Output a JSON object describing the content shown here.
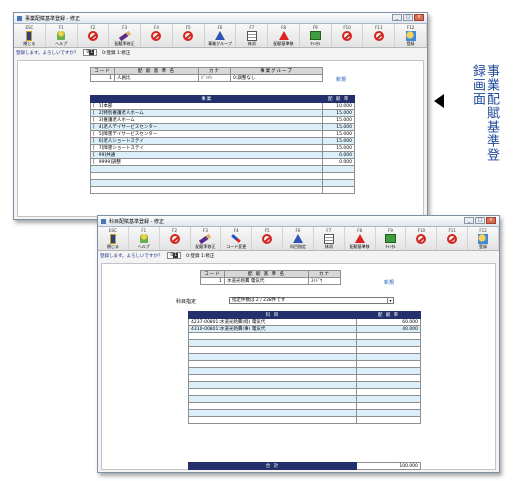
{
  "labels": {
    "arrow_label": "事業配賦基準登録画面"
  },
  "window1": {
    "title": "事業配賦基準登録 - 修正",
    "buttons": [
      {
        "key": "ESC",
        "label": "閉じる",
        "icon": "exit-door-icon"
      },
      {
        "key": "F1",
        "label": "ヘルプ",
        "icon": "help-icon"
      },
      {
        "key": "F2",
        "label": "",
        "icon": "disabled-icon"
      },
      {
        "key": "F3",
        "label": "配賦率修正",
        "icon": "pen-icon"
      },
      {
        "key": "F4",
        "label": "",
        "icon": "disabled-icon"
      },
      {
        "key": "F5",
        "label": "",
        "icon": "disabled-icon"
      },
      {
        "key": "F6",
        "label": "事業グループ",
        "icon": "triangle-icon"
      },
      {
        "key": "F7",
        "label": "抹消",
        "icon": "calculator-icon"
      },
      {
        "key": "F8",
        "label": "配賦基準移",
        "icon": "warning-icon"
      },
      {
        "key": "F9",
        "label": "ｷｬﾝｾﾙ",
        "icon": "check-icon"
      },
      {
        "key": "F10",
        "label": "",
        "icon": "disabled-icon"
      },
      {
        "key": "F11",
        "label": "",
        "icon": "disabled-icon"
      },
      {
        "key": "F12",
        "label": "登録",
        "icon": "register-icon"
      }
    ],
    "status": {
      "message": "登録します。よろしいですか？",
      "mode_prefix": "0",
      "mode_value": "1",
      "options": "0:登録  1:修正"
    },
    "master": {
      "headers": [
        "コード",
        "配 賦 基 準 名",
        "カナ",
        "事業グループ"
      ],
      "row": [
        "1",
        "人員比",
        "ｼﾞﾝｲﾝ",
        "0:調整なし"
      ],
      "new_link": "新規"
    },
    "detail": {
      "headers": [
        "事業",
        "配 賦 率"
      ],
      "rows": [
        [
          "[",
          "1]本部",
          "10.000"
        ],
        [
          "[",
          "2]特別養護老人ホーム",
          "15.000"
        ],
        [
          "[",
          "3]養護老人ホーム",
          "15.000"
        ],
        [
          "[",
          "4]老人デイサービスセンター",
          "15.000"
        ],
        [
          "[",
          "5]障害デイサービスセンター",
          "15.000"
        ],
        [
          "[",
          "6]老人ショートステイ",
          "15.000"
        ],
        [
          "[",
          "7]障害ショートステイ",
          "15.000"
        ],
        [
          "[",
          "99]共通",
          "0.000"
        ],
        [
          "[",
          "9999]調整",
          "0.000"
        ],
        [
          "",
          "",
          ""
        ],
        [
          "",
          "",
          ""
        ],
        [
          "",
          "",
          ""
        ],
        [
          "",
          "",
          ""
        ]
      ]
    }
  },
  "window2": {
    "title": "科目配賦基準登録 - 修正",
    "buttons": [
      {
        "key": "ESC",
        "label": "閉じる",
        "icon": "exit-door-icon"
      },
      {
        "key": "F1",
        "label": "ヘルプ",
        "icon": "help-icon"
      },
      {
        "key": "F2",
        "label": "",
        "icon": "disabled-icon"
      },
      {
        "key": "F3",
        "label": "配賦率修正",
        "icon": "pen-icon"
      },
      {
        "key": "F4",
        "label": "コード変更",
        "icon": "wand-icon"
      },
      {
        "key": "F5",
        "label": "",
        "icon": "disabled-icon"
      },
      {
        "key": "F6",
        "label": "科目指定",
        "icon": "triangle-icon"
      },
      {
        "key": "F7",
        "label": "抹消",
        "icon": "calculator-icon"
      },
      {
        "key": "F8",
        "label": "配賦基準移",
        "icon": "warning-icon"
      },
      {
        "key": "F9",
        "label": "ｷｬﾝｾﾙ",
        "icon": "check-icon"
      },
      {
        "key": "F10",
        "label": "",
        "icon": "disabled-icon"
      },
      {
        "key": "F11",
        "label": "",
        "icon": "disabled-icon"
      },
      {
        "key": "F12",
        "label": "登録",
        "icon": "register-icon"
      }
    ],
    "status": {
      "message": "登録します。よろしいですか？",
      "mode_prefix": "0",
      "mode_value": "1",
      "options": "0:登録  1:修正"
    },
    "master": {
      "headers": [
        "コード",
        "配 賦 基 準 名",
        "カナ"
      ],
      "row": [
        "1",
        "水道光熱費 電気代",
        "ｽｲﾄﾞｳ"
      ],
      "new_link": "新規"
    },
    "account_filter": {
      "label": "科目指定",
      "value": "指定件数は 2 / 238件です"
    },
    "detail": {
      "headers": [
        "科 目",
        "配 賦 率"
      ],
      "rows": [
        [
          "4237-00801:水道光熱費(経) 電気代",
          "60.000"
        ],
        [
          "4310-00801:水道光熱費(事) 電気代",
          "40.000"
        ],
        [
          "",
          ""
        ],
        [
          "",
          ""
        ],
        [
          "",
          ""
        ],
        [
          "",
          ""
        ],
        [
          "",
          ""
        ],
        [
          "",
          ""
        ],
        [
          "",
          ""
        ],
        [
          "",
          ""
        ],
        [
          "",
          ""
        ],
        [
          "",
          ""
        ],
        [
          "",
          ""
        ],
        [
          "",
          ""
        ],
        [
          "",
          ""
        ]
      ],
      "total_label": "合  計",
      "total_value": "100.000"
    }
  }
}
